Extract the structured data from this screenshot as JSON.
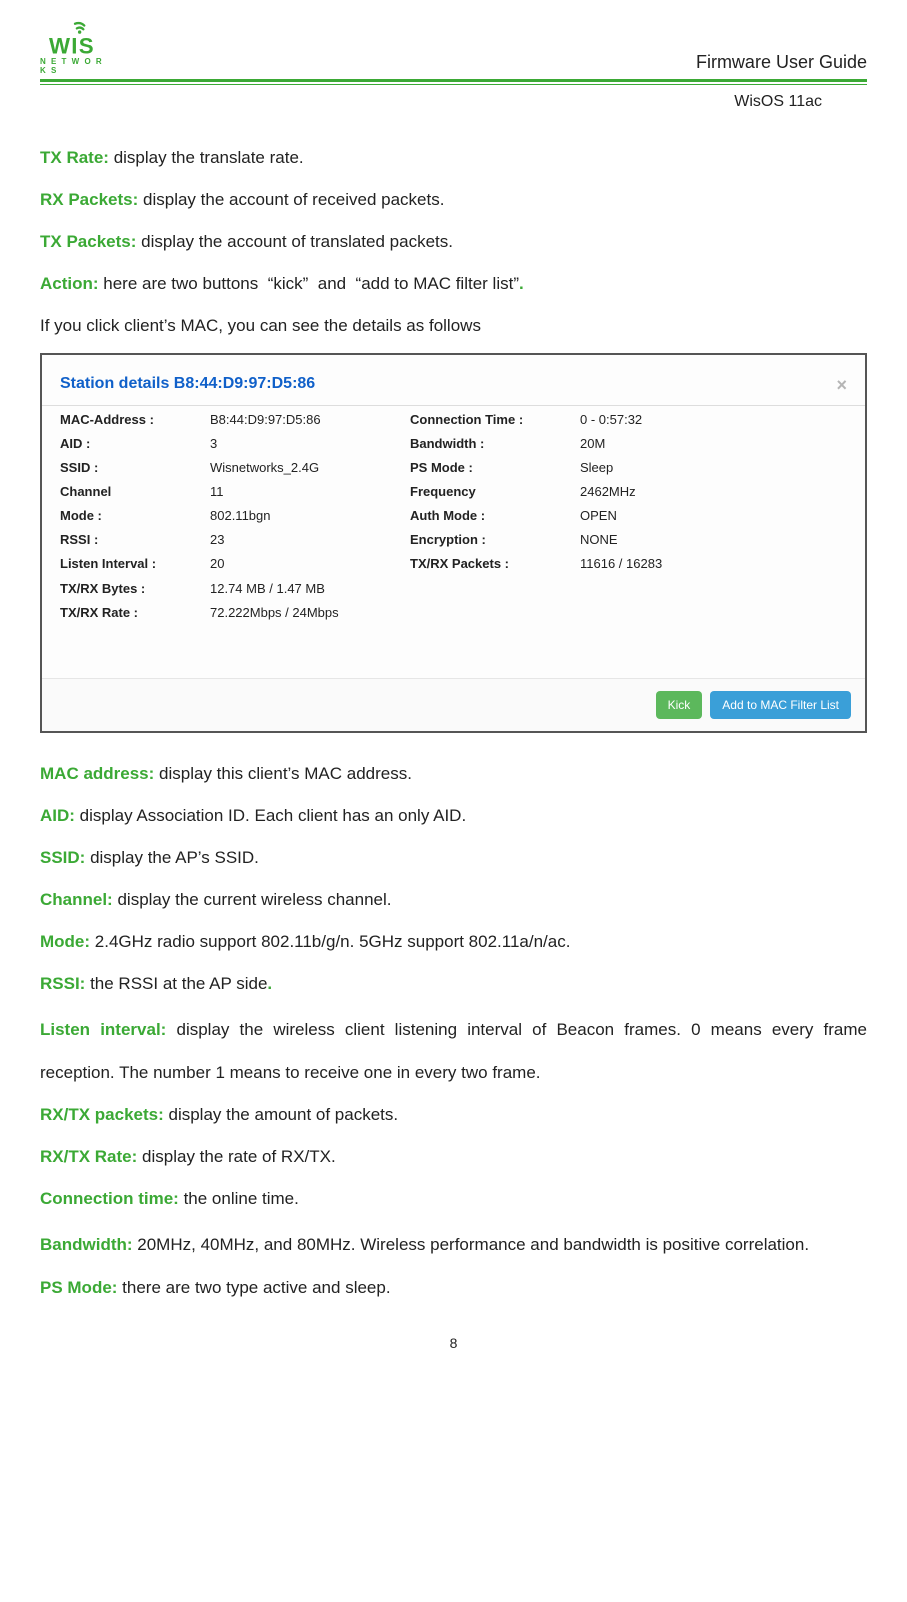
{
  "header": {
    "brand_letters": "WIS",
    "brand_sub": "N E T W O R K S",
    "doc_title": "Firmware User Guide",
    "sub_title": "WisOS 11ac"
  },
  "intro_defs": [
    {
      "term": "TX Rate:",
      "desc": " display the translate rate."
    },
    {
      "term": "RX Packets:",
      "desc": " display the account of received packets."
    },
    {
      "term": "TX Packets:",
      "desc": " display the account of translated packets."
    }
  ],
  "action_line": {
    "term": "Action:",
    "p1": " here are two buttons  “kick”  and  “add to MAC filter list”",
    "dot": "."
  },
  "click_line": "If you click client’s MAC, you can see the details as follows",
  "modal": {
    "title_prefix": "Station details ",
    "title_mac": "B8:44:D9:97:D5:86",
    "rows4": [
      {
        "l1": "MAC-Address :",
        "v1": "B8:44:D9:97:D5:86",
        "l2": "Connection Time :",
        "v2": "0 - 0:57:32"
      },
      {
        "l1": "AID :",
        "v1": "3",
        "l2": "Bandwidth :",
        "v2": "20M"
      },
      {
        "l1": "SSID :",
        "v1": "Wisnetworks_2.4G",
        "l2": "PS Mode :",
        "v2": "Sleep"
      },
      {
        "l1": "Channel",
        "v1": "11",
        "l2": "Frequency",
        "v2": "2462MHz"
      },
      {
        "l1": "Mode :",
        "v1": "802.11bgn",
        "l2": "Auth Mode :",
        "v2": "OPEN"
      },
      {
        "l1": "RSSI :",
        "v1": "23",
        "l2": "Encryption :",
        "v2": "NONE"
      },
      {
        "l1": "Listen Interval :",
        "v1": "20",
        "l2": "TX/RX Packets :",
        "v2": "11616 / 16283"
      }
    ],
    "rows2": [
      {
        "l": "TX/RX Bytes :",
        "v": "12.74 MB / 1.47 MB"
      },
      {
        "l": "TX/RX Rate :",
        "v": "72.222Mbps / 24Mbps"
      }
    ],
    "btn_kick": "Kick",
    "btn_add": "Add to MAC Filter List"
  },
  "post_defs": [
    {
      "term": "MAC address:",
      "desc": " display this client’s MAC address."
    },
    {
      "term": "AID:",
      "desc": " display Association ID. Each client has an only AID."
    },
    {
      "term": "SSID:",
      "desc": " display the AP’s SSID."
    },
    {
      "term": "Channel:",
      "desc": " display the current wireless channel."
    },
    {
      "term": "Mode:",
      "desc": " 2.4GHz radio support 802.11b/g/n. 5GHz support 802.11a/n/ac."
    }
  ],
  "rssi_line": {
    "term": "RSSI:",
    "desc": " the RSSI at the AP side",
    "dot": "."
  },
  "listen_interval": {
    "term": "Listen interval:",
    "desc": " display the wireless client listening interval of Beacon frames. 0 means every frame reception. The number 1 means to receive one in every two frame."
  },
  "tail_defs": [
    {
      "term": "RX/TX packets:",
      "desc": " display the amount of packets."
    },
    {
      "term": "RX/TX Rate:",
      "desc": " display the rate of RX/TX."
    },
    {
      "term": "Connection time:",
      "desc": " the online time."
    }
  ],
  "bandwidth": {
    "term": "Bandwidth:",
    "desc": " 20MHz, 40MHz, and 80MHz. Wireless performance and bandwidth is positive correlation."
  },
  "psmode": {
    "term": "PS Mode:",
    "desc": " there are two type active and sleep."
  },
  "page_num": "8"
}
